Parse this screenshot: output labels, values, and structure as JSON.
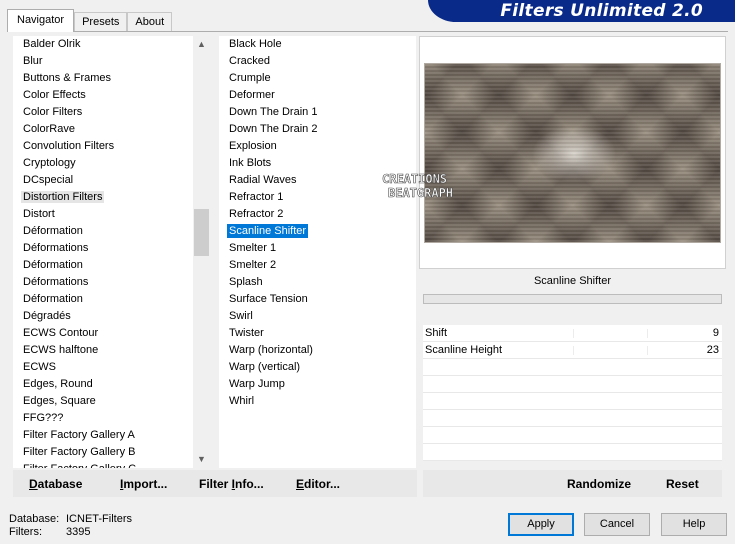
{
  "tabs": [
    {
      "label": "Navigator"
    },
    {
      "label": "Presets"
    },
    {
      "label": "About"
    }
  ],
  "title": "Filters Unlimited 2.0",
  "categories": [
    "Balder Olrik",
    "Blur",
    "Buttons & Frames",
    "Color Effects",
    "Color Filters",
    "ColorRave",
    "Convolution Filters",
    "Cryptology",
    "DCspecial",
    "Distortion Filters",
    "Distort",
    "Déformation",
    "Déformations",
    "Déformation",
    "Déformations",
    "Déformation",
    "Dégradés",
    "ECWS Contour",
    "ECWS halftone",
    "ECWS",
    "Edges, Round",
    "Edges, Square",
    "FFG???",
    "Filter Factory Gallery A",
    "Filter Factory Gallery B",
    "Filter Factory Gallery C"
  ],
  "selected_category": "Distortion Filters",
  "filters": [
    "Black Hole",
    "Cracked",
    "Crumple",
    "Deformer",
    "Down The Drain 1",
    "Down The Drain 2",
    "Explosion",
    "Ink Blots",
    "Radial Waves",
    "Refractor 1",
    "Refractor 2",
    "Scanline Shifter",
    "Smelter 1",
    "Smelter 2",
    "Splash",
    "Surface Tension",
    "Swirl",
    "Twister",
    "Warp (horizontal)",
    "Warp (vertical)",
    "Warp Jump",
    "Whirl"
  ],
  "selected_filter": "Scanline Shifter",
  "watermark": {
    "line1": "CREATIONS",
    "line2": "BEATGRAPH"
  },
  "filter_name": "Scanline Shifter",
  "params": [
    {
      "name": "Shift",
      "value": "9"
    },
    {
      "name": "Scanline Height",
      "value": "23"
    }
  ],
  "left_buttons": {
    "database": {
      "u": "D",
      "rest": "atabase"
    },
    "import": {
      "u": "I",
      "rest": "mport..."
    },
    "filter_info": {
      "pre": "Filter ",
      "u": "I",
      "rest": "nfo..."
    },
    "editor": {
      "u": "E",
      "rest": "ditor..."
    }
  },
  "randomize_label": "Randomize",
  "reset_label": "Reset",
  "status": {
    "database_label": "Database:",
    "database_value": "ICNET-Filters",
    "filters_label": "Filters:",
    "filters_value": "3395"
  },
  "dialog_buttons": {
    "apply": "Apply",
    "cancel": "Cancel",
    "help": "Help"
  },
  "colors": {
    "banner": "#0a2a8a",
    "selection": "#0078d7",
    "default_button_border": "#0078d7"
  }
}
